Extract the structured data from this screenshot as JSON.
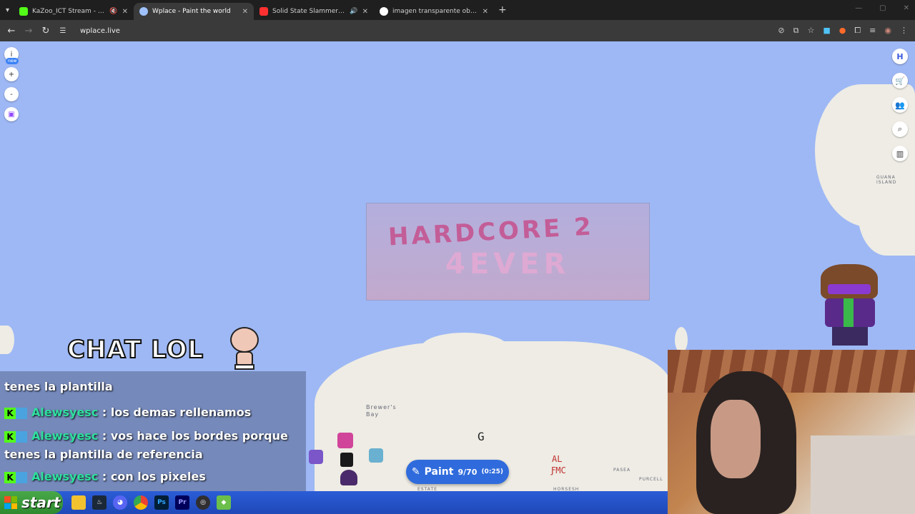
{
  "browser": {
    "tabs": [
      {
        "title": "KaZoo_ICT Stream - Watch",
        "color": "#53fc18"
      },
      {
        "title": "Wplace - Paint the world",
        "color": "#9fc2ff"
      },
      {
        "title": "Solid State Slammer (Solid",
        "color": "#ff3030"
      },
      {
        "title": "imagen transparente obs - Bus",
        "color": "#ffffff"
      }
    ],
    "url": "wplace.live"
  },
  "map": {
    "labels": {
      "guana": "GUANA ISLAND",
      "brewers": "Brewer's Bay",
      "pasea": "PASEA",
      "purcell": "PURCELL",
      "estate": "ESTATE",
      "horseshoe": "HORSESH"
    },
    "left_tools": {
      "info": "i",
      "new_badge": "new",
      "zoom_in": "+",
      "zoom_out": "-"
    },
    "pixel_text": {
      "al": "AL",
      "fmc": "ƑMC",
      "g": "G"
    }
  },
  "banner": {
    "title": "HARDCORE 2",
    "subtitle": "4EVER"
  },
  "overlay": {
    "chat_title": "CHAT LOL"
  },
  "chat": {
    "partial_line": "tenes la plantilla",
    "messages": [
      {
        "user": "Alewsyesc",
        "text": "los demas rellenamos"
      },
      {
        "user": "Alewsyesc",
        "text": "vos hace los bordes porque tenes la plantilla de referencia"
      },
      {
        "user": "Alewsyesc",
        "text": "con los pixeles"
      }
    ]
  },
  "paint": {
    "label": "Paint",
    "count": "9/70",
    "timer": "(0:25)"
  },
  "taskbar": {
    "start": "start"
  }
}
